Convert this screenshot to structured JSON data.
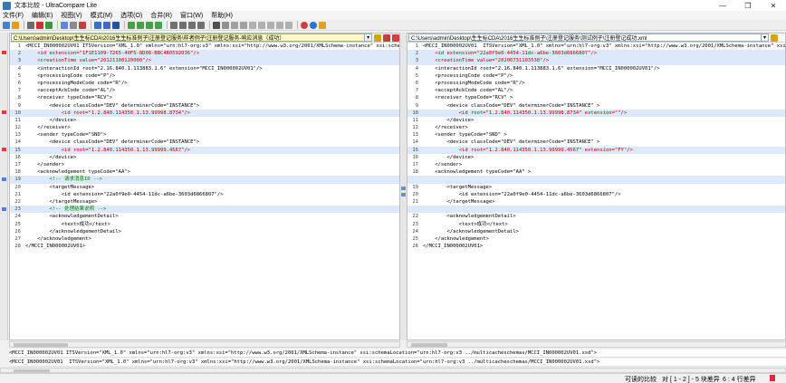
{
  "window": {
    "title": "文本比较 - UltraCompare Lite",
    "controls": [
      "—",
      "❐",
      "✕"
    ]
  },
  "menu": [
    "文件(F)",
    "编辑(E)",
    "视图(V)",
    "模式(M)",
    "选项(O)",
    "合并(R)",
    "窗口(W)",
    "帮助(H)"
  ],
  "left": {
    "path": "C:\\Users\\admin\\Desktop\\生生标CDA\\2016生生标准例子\\注册登记服务\\样者例子\\注册登记服务-响应消息（成功）",
    "lines": [
      {
        "n": "1",
        "text": "<MCCI_IN000002UV01 ITSVersion=\"XML_1.0\" xmlns=\"urn:hl7-org:v3\" xmlns:xsi=\"http://www.w3.org/2001/XMLSchema-instance\" xsi:schemaLocation=",
        "diff": false,
        "color": "plain"
      },
      {
        "n": "2",
        "text": "    <id extension=\"1F1E1109-7265-40F5-8D08-BBC4B0592036\"/>",
        "diff": true,
        "color": "red"
      },
      {
        "n": "3",
        "text": "    <creationTime value=\"20121108120000\"/>",
        "diff": true,
        "color": "red"
      },
      {
        "n": "4",
        "text": "    <interactionId root=\"2.16.840.1.113883.1.6\" extension=\"MCCI_IN000002UV01\"/>",
        "diff": false,
        "color": "plain"
      },
      {
        "n": "5",
        "text": "    <processingCode code=\"P\"/>",
        "diff": false,
        "color": "plain"
      },
      {
        "n": "6",
        "text": "    <processingModeCode code=\"R\"/>",
        "diff": false,
        "color": "plain"
      },
      {
        "n": "7",
        "text": "    <acceptAckCode code=\"AL\"/>",
        "diff": false,
        "color": "plain"
      },
      {
        "n": "8",
        "text": "    <receiver typeCode=\"RCV\">",
        "diff": false,
        "color": "plain"
      },
      {
        "n": "9",
        "text": "        <device classCode=\"DEV\" determinerCode=\"INSTANCE\">",
        "diff": false,
        "color": "plain"
      },
      {
        "n": "10",
        "text": "            <id root=\"1.2.840.114350.1.13.99998.8734\"/>",
        "diff": true,
        "color": "red"
      },
      {
        "n": "11",
        "text": "        </device>",
        "diff": false,
        "color": "plain"
      },
      {
        "n": "12",
        "text": "    </receiver>",
        "diff": false,
        "color": "plain"
      },
      {
        "n": "13",
        "text": "    <sender typeCode=\"SND\">",
        "diff": false,
        "color": "plain"
      },
      {
        "n": "14",
        "text": "        <device classCode=\"DEV\" determinerCode=\"INSTANCE\">",
        "diff": false,
        "color": "plain"
      },
      {
        "n": "15",
        "text": "            <id root=\"1.2.840.114350.1.13.99999.4567\"/>",
        "diff": true,
        "color": "red"
      },
      {
        "n": "16",
        "text": "        </device>",
        "diff": false,
        "color": "plain"
      },
      {
        "n": "17",
        "text": "    </sender>",
        "diff": false,
        "color": "plain"
      },
      {
        "n": "18",
        "text": "    <acknowledgement typeCode=\"AA\">",
        "diff": false,
        "color": "plain"
      },
      {
        "n": "19",
        "text": "        <!-- 请求消息ID -->",
        "diff": true,
        "color": "green"
      },
      {
        "n": "20",
        "text": "        <targetMessage>",
        "diff": false,
        "color": "plain"
      },
      {
        "n": "21",
        "text": "            <id extension=\"22a0f9e0-4454-11dc-a6be-3603d6866807\"/>",
        "diff": false,
        "color": "plain"
      },
      {
        "n": "22",
        "text": "        </targetMessage>",
        "diff": false,
        "color": "plain"
      },
      {
        "n": "23",
        "text": "        <!-- 处理结果说明 -->",
        "diff": true,
        "color": "green"
      },
      {
        "n": "24",
        "text": "        <acknowledgementDetail>",
        "diff": false,
        "color": "plain"
      },
      {
        "n": "25",
        "text": "            <text>成功</text>",
        "diff": false,
        "color": "plain"
      },
      {
        "n": "26",
        "text": "        </acknowledgementDetail>",
        "diff": false,
        "color": "plain"
      },
      {
        "n": "27",
        "text": "    </acknowledgement>",
        "diff": false,
        "color": "plain"
      },
      {
        "n": "28",
        "text": "</MCCI_IN000002UV01>",
        "diff": false,
        "color": "plain"
      }
    ]
  },
  "right": {
    "path": "C:\\Users\\admin\\Desktop\\生生标CDA\\2016生生标准例子\\注册登记服务\\测试例子\\注册登记成功.xml",
    "lines": [
      {
        "n": "1",
        "text": "<MCCI_IN000002UV01  ITSVersion=\"XML_1.0\" xmlns=\"urn:hl7-org:v3\" xmlns:xsi=\"http://www.w3.org/2001/XMLSchema-instance\" xsi:sche",
        "diff": false,
        "color": "plain"
      },
      {
        "n": "2",
        "text": "    <id extension=\"22a0f9e0-4454-11dc-a6be-3603d6866807\"/>",
        "diff": true,
        "color": "red"
      },
      {
        "n": "3",
        "text": "    <creationTime value=\"20200731103538\"/>",
        "diff": true,
        "color": "red"
      },
      {
        "n": "4",
        "text": "    <interactionId root=\"2.16.840.1.113883.1.6\" extension=\"MCCI_IN000002UV01\"/>",
        "diff": false,
        "color": "plain"
      },
      {
        "n": "5",
        "text": "    <processingCode code=\"P\"/>",
        "diff": false,
        "color": "plain"
      },
      {
        "n": "6",
        "text": "    <processingModeCode code=\"R\"/>",
        "diff": false,
        "color": "plain"
      },
      {
        "n": "7",
        "text": "    <acceptAckCode code=\"AL\"/>",
        "diff": false,
        "color": "plain"
      },
      {
        "n": "8",
        "text": "    <receiver typeCode=\"RCV\" >",
        "diff": false,
        "color": "plain"
      },
      {
        "n": "9",
        "text": "        <device classCode=\"DEV\" determinerCode=\"INSTANCE\" >",
        "diff": false,
        "color": "plain"
      },
      {
        "n": "10",
        "text": "            <id root=\"1.2.840.114350.1.13.99998.8734\" extension=\"\"/>",
        "diff": true,
        "color": "red"
      },
      {
        "n": "11",
        "text": "        </device>",
        "diff": false,
        "color": "plain"
      },
      {
        "n": "12",
        "text": "    </receiver>",
        "diff": false,
        "color": "plain"
      },
      {
        "n": "13",
        "text": "    <sender typeCode=\"SND\" >",
        "diff": false,
        "color": "plain"
      },
      {
        "n": "14",
        "text": "        <device classCode=\"DEV\" determinerCode=\"INSTANCE\" >",
        "diff": false,
        "color": "plain"
      },
      {
        "n": "15",
        "text": "            <id root=\"1.2.840.114350.1.13.99999.4567\" extension=\"FY\"/>",
        "diff": true,
        "color": "red"
      },
      {
        "n": "16",
        "text": "        </device>",
        "diff": false,
        "color": "plain"
      },
      {
        "n": "17",
        "text": "    </sender>",
        "diff": false,
        "color": "plain"
      },
      {
        "n": "18",
        "text": "    <acknowledgement typeCode=\"AA\" >",
        "diff": false,
        "color": "plain"
      },
      {
        "n": "",
        "text": "",
        "diff": true,
        "color": "plain"
      },
      {
        "n": "19",
        "text": "        <targetMessage>",
        "diff": false,
        "color": "plain"
      },
      {
        "n": "20",
        "text": "            <id extension=\"22a0f9e0-4454-11dc-a6be-3603d6866807\"/>",
        "diff": false,
        "color": "plain"
      },
      {
        "n": "21",
        "text": "        </targetMessage>",
        "diff": false,
        "color": "plain"
      },
      {
        "n": "",
        "text": "",
        "diff": true,
        "color": "plain"
      },
      {
        "n": "22",
        "text": "        <acknowledgementDetail>",
        "diff": false,
        "color": "plain"
      },
      {
        "n": "23",
        "text": "            <text>成功</text>",
        "diff": false,
        "color": "plain"
      },
      {
        "n": "24",
        "text": "        </acknowledgementDetail>",
        "diff": false,
        "color": "plain"
      },
      {
        "n": "25",
        "text": "    </acknowledgement>",
        "diff": false,
        "color": "plain"
      },
      {
        "n": "26",
        "text": "</MCCI_IN000002UV01>",
        "diff": false,
        "color": "plain"
      }
    ]
  },
  "compare": {
    "line1": "<MCCI_IN000002UV01 ITSVersion=\"XML_1.0\" xmlns=\"urn:hl7-org:v3\" xmlns:xsi=\"http://www.w3.org/2001/XMLSchema-instance\" xsi:schemaLocation=\"urn:hl7-org:v3 ../multicacheschemas/MCCI_IN000002UV01.xsd\">",
    "line2": "<MCCI_IN000002UV01  ITSVersion=\"XML_1.0\" xmlns=\"urn:hl7-org:v3\" xmlns:xsi=\"http://www.w3.org/2001/XMLSchema-instance\" xsi:schemaLocation=\"urn:hl7-org:v3 ../multicacheschemas/MCCI_IN000002UV01.xsd\">"
  },
  "status": {
    "mode": "可读的比较",
    "position": "对 [ 1 - 2 ] - 5 块差异",
    "rows": "6 : 4 行差异"
  },
  "colors": {
    "diff_bg": "#dbe9fb",
    "red": "#c00000",
    "green": "#008000"
  }
}
